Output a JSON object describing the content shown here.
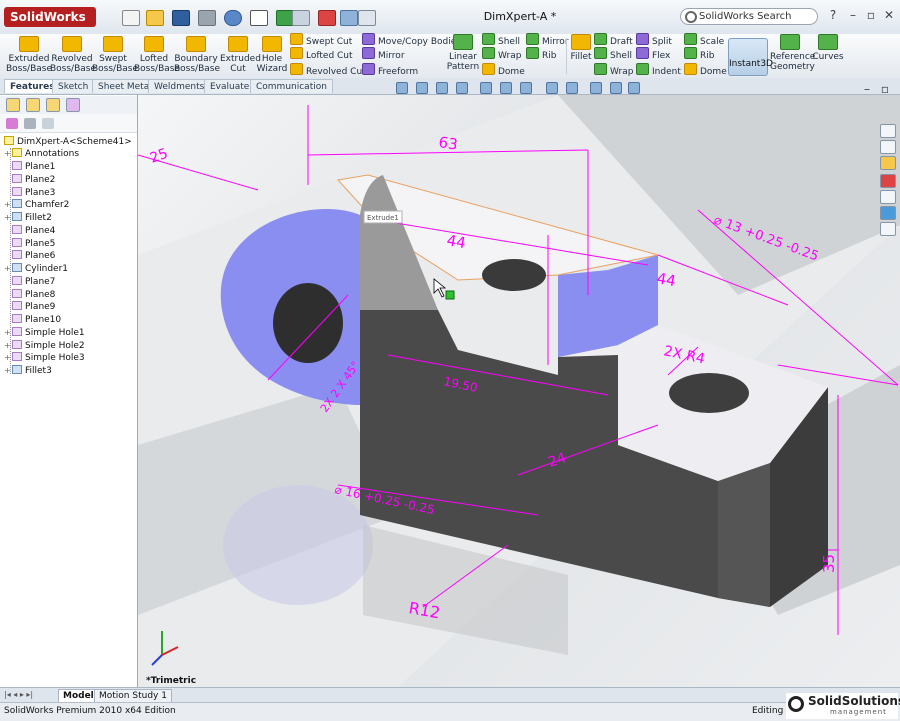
{
  "app": {
    "name": "SolidWorks",
    "document_title": "DimXpert-A *",
    "search_placeholder": "SolidWorks Search"
  },
  "ribbon": {
    "large_buttons": [
      {
        "label": "Extruded Boss/Base"
      },
      {
        "label": "Revolved Boss/Base"
      },
      {
        "label": "Swept Boss/Base"
      },
      {
        "label": "Lofted Boss/Base"
      },
      {
        "label": "Boundary Boss/Base"
      },
      {
        "label": "Extruded Cut"
      },
      {
        "label": "Hole Wizard"
      }
    ],
    "cut_group": [
      "Swept Cut",
      "Lofted Cut",
      "Revolved Cut"
    ],
    "move_group": [
      "Move/Copy Bodies",
      "Mirror",
      "Freeform"
    ],
    "linear_pattern": "Linear Pattern",
    "shell_group": [
      "Shell",
      "Wrap",
      "Dome"
    ],
    "mirror_group": [
      "Mirror",
      "Rib"
    ],
    "fillet": "Fillet",
    "draft_group": [
      "Draft",
      "Shell",
      "Wrap"
    ],
    "split_group": [
      "Split",
      "Flex",
      "Indent"
    ],
    "scale_group": [
      "Scale",
      "Rib",
      "Dome"
    ],
    "instant3d": "Instant3D",
    "reference_geometry": "Reference Geometry",
    "curves": "Curves"
  },
  "tabs": [
    "Features",
    "Sketch",
    "Sheet Metal",
    "Weldments",
    "Evaluate",
    "Communication"
  ],
  "feature_tree": {
    "root": "DimXpert-A<Scheme41>",
    "items": [
      {
        "label": "Annotations",
        "icon": "annotations-icon"
      },
      {
        "label": "Plane1",
        "icon": "plane-icon"
      },
      {
        "label": "Plane2",
        "icon": "plane-icon"
      },
      {
        "label": "Plane3",
        "icon": "plane-icon"
      },
      {
        "label": "Chamfer2",
        "icon": "chamfer-icon"
      },
      {
        "label": "Fillet2",
        "icon": "fillet-icon"
      },
      {
        "label": "Plane4",
        "icon": "plane-icon"
      },
      {
        "label": "Plane5",
        "icon": "plane-icon"
      },
      {
        "label": "Plane6",
        "icon": "plane-icon"
      },
      {
        "label": "Cylinder1",
        "icon": "cylinder-icon"
      },
      {
        "label": "Plane7",
        "icon": "plane-icon"
      },
      {
        "label": "Plane8",
        "icon": "plane-icon"
      },
      {
        "label": "Plane9",
        "icon": "plane-icon"
      },
      {
        "label": "Plane10",
        "icon": "plane-icon"
      },
      {
        "label": "Simple Hole1",
        "icon": "hole-icon"
      },
      {
        "label": "Simple Hole2",
        "icon": "hole-icon"
      },
      {
        "label": "Simple Hole3",
        "icon": "hole-icon"
      },
      {
        "label": "Fillet3",
        "icon": "fillet-icon"
      }
    ]
  },
  "viewport": {
    "view_orientation": "*Trimetric",
    "tooltip": "Extrude1",
    "dimensions": {
      "d63": "63",
      "d25": "25",
      "d44_top": "44",
      "d44_side": "44",
      "hole_13": "⌀ 13 +0.25 -0.25",
      "radius_2x": "2X R4",
      "d19_50": "19.50",
      "chamfer": "2X 2 X 45°",
      "d24": "24",
      "hole_16": "⌀ 16 +0.25 -0.25",
      "r12": "R12",
      "d35": "35"
    }
  },
  "bottom_tabs": [
    "Model",
    "Motion Study 1"
  ],
  "status_bar": {
    "left": "SolidWorks Premium 2010 x64 Edition",
    "right": "Editing P"
  },
  "watermark": {
    "name": "SolidSolutions",
    "subtitle": "management"
  },
  "colors": {
    "dimension": "#ff00ff",
    "face_blue": "#8a8ef0",
    "body_dark": "#4a4a4a"
  }
}
